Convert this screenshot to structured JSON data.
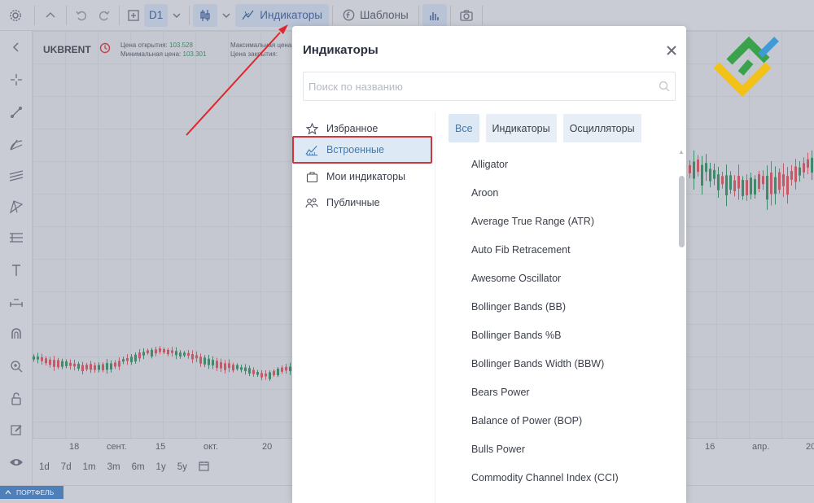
{
  "toolbar": {
    "interval": "D1",
    "indicators_label": "Индикаторы",
    "templates_label": "Шаблоны"
  },
  "chart": {
    "symbol": "UKBRENT",
    "open_label": "Цена открытия:",
    "open_value": "103.528",
    "low_label": "Минимальная цена:",
    "low_value": "103.301",
    "high_label": "Максимальная цена",
    "close_label": "Цена закрытия:",
    "x_labels": [
      "18",
      "сент.",
      "15",
      "окт.",
      "20",
      "16",
      "апр.",
      "20"
    ],
    "periods": [
      "1d",
      "7d",
      "1m",
      "3m",
      "6m",
      "1y",
      "5y"
    ],
    "bull_color": "#3f8a6a",
    "bear_color": "#c45a68"
  },
  "statusbar": {
    "portfolio_label": "ПОРТФЕЛЬ"
  },
  "modal": {
    "title": "Индикаторы",
    "search_placeholder": "Поиск по названию",
    "categories": [
      {
        "label": "Избранное",
        "icon": "star-icon"
      },
      {
        "label": "Встроенные",
        "icon": "builtin-chart-icon"
      },
      {
        "label": "Мои индикаторы",
        "icon": "briefcase-icon"
      },
      {
        "label": "Публичные",
        "icon": "users-icon"
      }
    ],
    "selected_category": "Встроенные",
    "filters": [
      "Все",
      "Индикаторы",
      "Осцилляторы"
    ],
    "active_filter": "Все",
    "indicators": [
      "Alligator",
      "Aroon",
      "Average True Range (ATR)",
      "Auto Fib Retracement",
      "Awesome Oscillator",
      "Bollinger Bands (BB)",
      "Bollinger Bands %B",
      "Bollinger Bands Width (BBW)",
      "Bears Power",
      "Balance of Power (BOP)",
      "Bulls Power",
      "Commodity Channel Index (CCI)"
    ]
  },
  "colors": {
    "annotation_red": "#e0262c",
    "accent_blue": "#4479ad",
    "logo_green": "#3aa24a",
    "logo_yellow": "#f2c21b",
    "logo_blue": "#3f9ad6"
  }
}
